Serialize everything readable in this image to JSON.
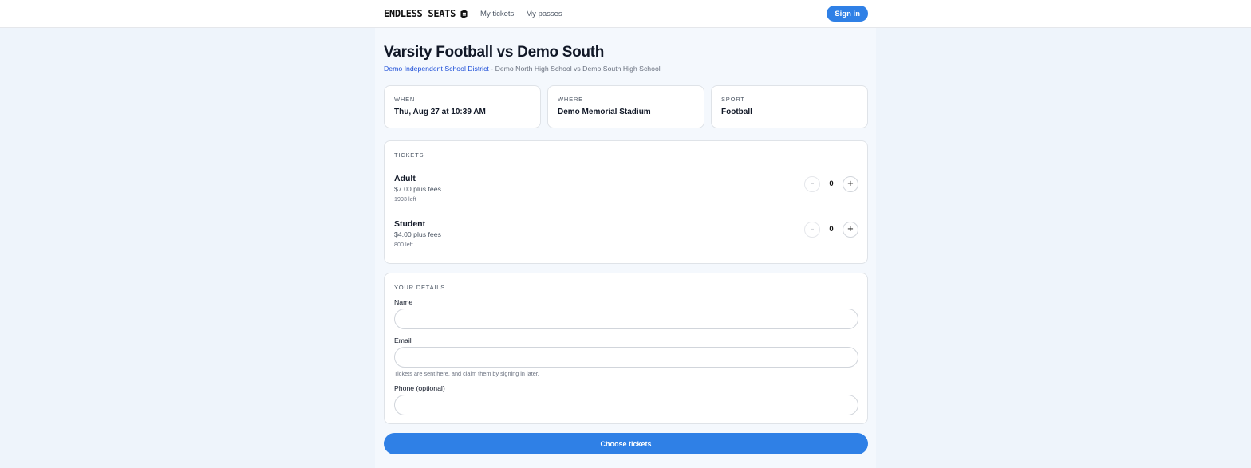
{
  "header": {
    "brand": "ENDLESS SEATS",
    "nav": [
      "My tickets",
      "My passes"
    ],
    "signin_label": "Sign in"
  },
  "event": {
    "title": "Varsity Football vs Demo South",
    "district": "Demo Independent School District",
    "separator": " - ",
    "matchup": "Demo North High School vs Demo South High School"
  },
  "info": [
    {
      "label": "WHEN",
      "value": "Thu, Aug 27 at 10:39 AM"
    },
    {
      "label": "WHERE",
      "value": "Demo Memorial Stadium"
    },
    {
      "label": "SPORT",
      "value": "Football"
    }
  ],
  "tickets": {
    "section_label": "TICKETS",
    "items": [
      {
        "name": "Adult",
        "price": "$7.00 plus fees",
        "remaining": "1993 left",
        "qty": "0"
      },
      {
        "name": "Student",
        "price": "$4.00 plus fees",
        "remaining": "800 left",
        "qty": "0"
      }
    ],
    "minus_glyph": "–",
    "plus_glyph": "+"
  },
  "details": {
    "section_label": "YOUR DETAILS",
    "name_label": "Name",
    "name_value": "",
    "email_label": "Email",
    "email_value": "",
    "email_hint": "Tickets are sent here, and claim them by signing in later.",
    "phone_label": "Phone (optional)",
    "phone_value": ""
  },
  "cta_label": "Choose tickets",
  "colors": {
    "accent": "#2f80e6",
    "link": "#1d4ed8"
  }
}
